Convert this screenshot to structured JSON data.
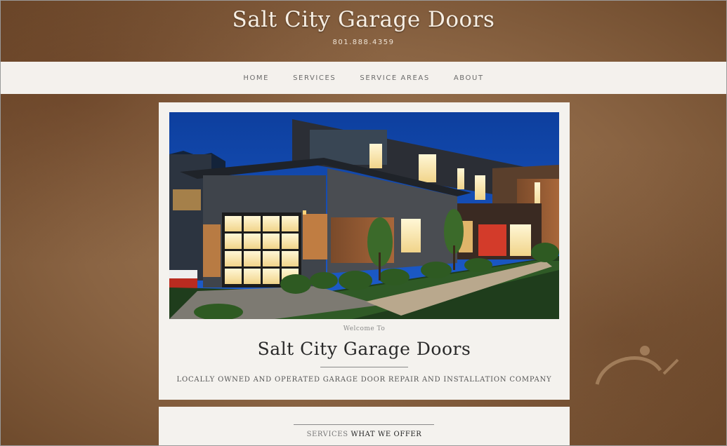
{
  "header": {
    "title": "Salt City Garage Doors",
    "phone": "801.888.4359"
  },
  "nav": {
    "items": [
      {
        "label": "HOME"
      },
      {
        "label": "SERVICES"
      },
      {
        "label": "SERVICE AREAS"
      },
      {
        "label": "ABOUT"
      }
    ]
  },
  "hero": {
    "welcome": "Welcome To",
    "title": "Salt City Garage Doors",
    "tagline": "LOCALLY OWNED AND OPERATED GARAGE DOOR REPAIR AND INSTALLATION COMPANY"
  },
  "services": {
    "kicker": "SERVICES",
    "title": "WHAT WE OFFER"
  },
  "colors": {
    "nav_bg": "#f4f1ed",
    "card_bg": "#f4f2ee",
    "background": "#8a6443",
    "title_text": "#f7efe4"
  }
}
